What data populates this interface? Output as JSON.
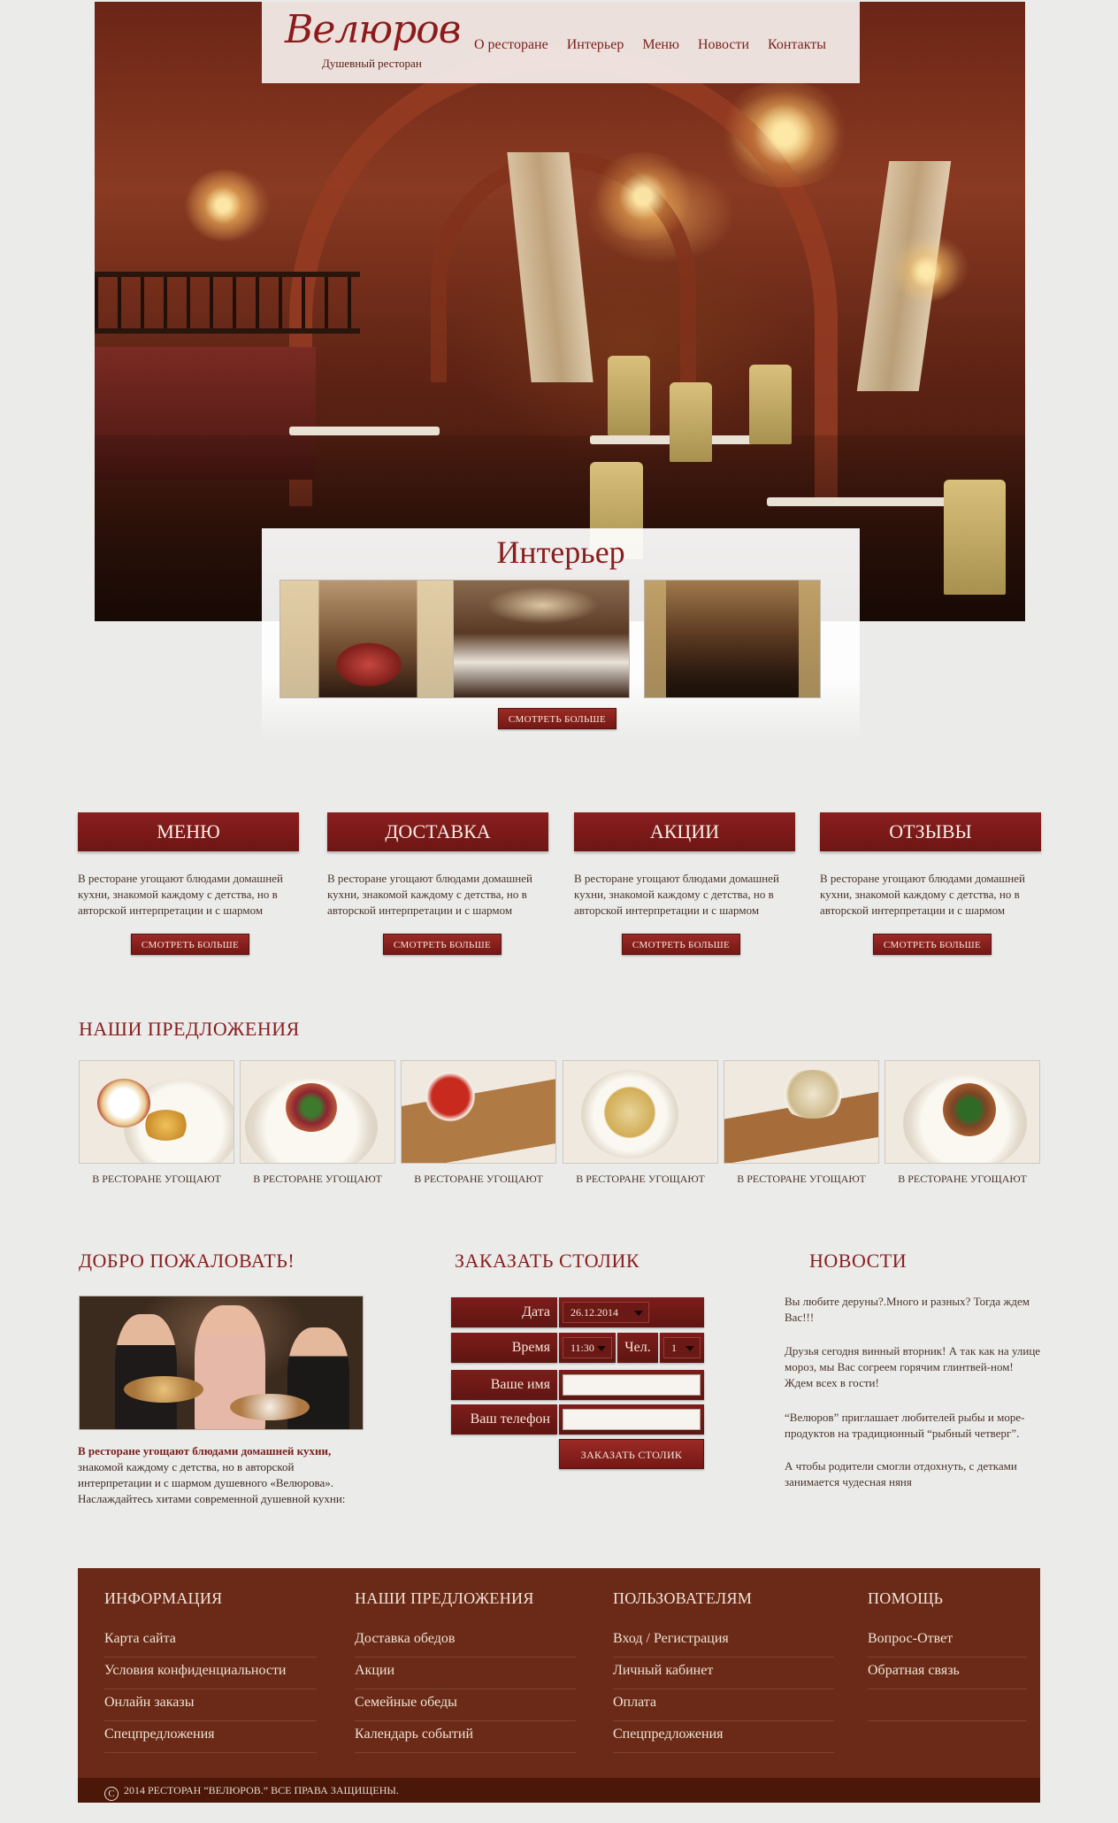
{
  "brand": {
    "name": "Велюров",
    "tagline": "Душевный ресторан"
  },
  "nav": [
    "О ресторане",
    "Интерьер",
    "Меню",
    "Новости",
    "Контакты"
  ],
  "interior": {
    "title": "Интерьер",
    "button": "СМОТРЕТЬ БОЛЬШЕ"
  },
  "features": [
    {
      "title": "МЕНЮ",
      "text": "В ресторане угощают блюдами домашней кухни, знакомой каждому с детства, но в авторской интерпретации и с шармом",
      "button": "СМОТРЕТЬ БОЛЬШЕ"
    },
    {
      "title": "ДОСТАВКА",
      "text": "В ресторане угощают блюдами домашней кухни, знакомой каждому с детства, но в авторской интерпретации и с шармом",
      "button": "СМОТРЕТЬ БОЛЬШЕ"
    },
    {
      "title": "АКЦИИ",
      "text": "В ресторане угощают блюдами домашней кухни, знакомой каждому с детства, но в авторской интерпретации и с шармом",
      "button": "СМОТРЕТЬ БОЛЬШЕ"
    },
    {
      "title": "ОТЗЫВЫ",
      "text": "В ресторане угощают блюдами домашней кухни, знакомой каждому с детства, но в авторской интерпретации и с шармом",
      "button": "СМОТРЕТЬ БОЛЬШЕ"
    }
  ],
  "offers": {
    "title": "НАШИ ПРЕДЛОЖЕНИЯ",
    "items": [
      "В РЕСТОРАНЕ УГОЩАЮТ",
      "В РЕСТОРАНЕ УГОЩАЮТ",
      "В РЕСТОРАНЕ УГОЩАЮТ",
      "В РЕСТОРАНЕ УГОЩАЮТ",
      "В РЕСТОРАНЕ УГОЩАЮТ",
      "В РЕСТОРАНЕ УГОЩАЮТ"
    ]
  },
  "welcome": {
    "title": "ДОБРО ПОЖАЛОВАТЬ!",
    "lead": "В ресторане угощают блюдами домашней кухни,",
    "text": "знакомой каждому с детства, но в авторской интерпретации и с шармом душевного «Велюрова». Наслаждайтесь хитами современной душевной кухни:"
  },
  "reserve": {
    "title": "ЗАКАЗАТЬ СТОЛИК",
    "date_label": "Дата",
    "date_value": "26.12.2014",
    "time_label": "Время",
    "time_value": "11:30",
    "guests_label": "Чел.",
    "guests_value": "1",
    "name_label": "Ваше имя",
    "phone_label": "Ваш телефон",
    "button": "ЗАКАЗАТЬ СТОЛИК"
  },
  "news": {
    "title": "НОВОСТИ",
    "items": [
      "Вы любите деруны?.Много и разных? Тогда ждем Вас!!!",
      "Друзья сегодня винный вторник!  А так как на улице мороз, мы Вас согреем горячим глинтвей-ном! Ждем всех в гости!",
      "“Велюров” приглашает любителей рыбы и море-продуктов на традиционный “рыбный четверг”.",
      "А чтобы родители смогли отдохнуть, с детками занимается чудесная няня"
    ]
  },
  "footer": {
    "columns": [
      {
        "title": "ИНФОРМАЦИЯ",
        "links": [
          "Карта сайта",
          "Условия конфиденциальности",
          "Онлайн заказы",
          "Спецпредложения"
        ]
      },
      {
        "title": "НАШИ ПРЕДЛОЖЕНИЯ",
        "links": [
          "Доставка обедов",
          "Акции",
          "Семейные обеды",
          "Календарь событий"
        ]
      },
      {
        "title": "ПОЛЬЗОВАТЕЛЯМ",
        "links": [
          "Вход / Регистрация",
          "Личный кабинет",
          "Оплата",
          "Спецпредложения"
        ]
      },
      {
        "title": "ПОМОЩЬ",
        "links": [
          "Вопрос-Ответ",
          "Обратная связь"
        ]
      }
    ],
    "copyright": "2014 РЕСТОРАН “ВЕЛЮРОВ.” ВСЕ ПРАВА ЗАЩИЩЕНЫ."
  },
  "colors": {
    "accent": "#7d1d1a",
    "footer_bg": "#6a2a17",
    "page_bg": "#ebebea",
    "heading": "#8a1d1d"
  }
}
